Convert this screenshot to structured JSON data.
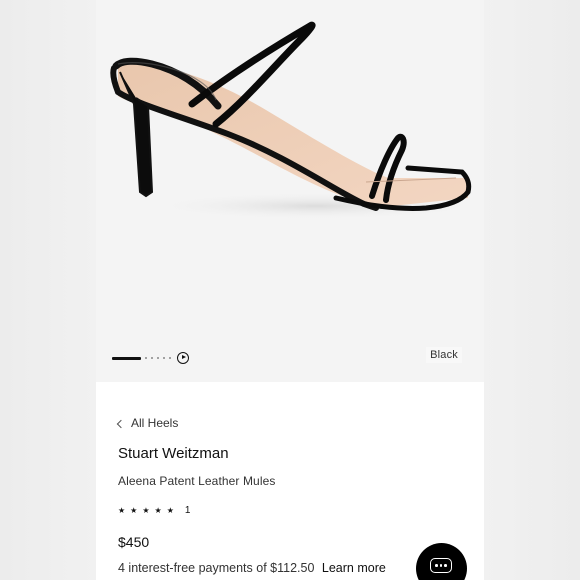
{
  "product": {
    "color_option": "Black",
    "breadcrumb": "All Heels",
    "brand": "Stuart Weitzman",
    "name": "Aleena Patent Leather Mules",
    "rating": {
      "stars": 5,
      "review_count": "1"
    },
    "price": "$450",
    "installments": {
      "text": "4 interest-free payments of $112.50",
      "link": "Learn more"
    }
  },
  "carousel": {
    "image_count": 7,
    "current_index": 1,
    "has_video": true
  },
  "icons": {
    "chat": "chat-bubble-icon",
    "play": "play-icon",
    "back": "chevron-left-icon",
    "star": "star-icon"
  },
  "colors": {
    "page_bg": "#eeeeee",
    "panel_bg": "#ffffff",
    "accent": "#000000"
  }
}
